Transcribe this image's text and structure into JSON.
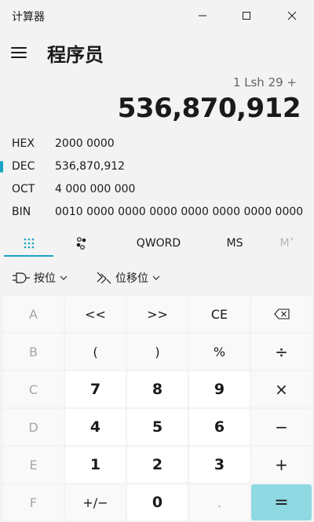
{
  "window": {
    "title": "计算器"
  },
  "header": {
    "mode_title": "程序员"
  },
  "display": {
    "expression": "1 Lsh 29 +",
    "result": "536,870,912"
  },
  "radix": [
    {
      "name": "HEX",
      "value": "2000 0000",
      "selected": false
    },
    {
      "name": "DEC",
      "value": "536,870,912",
      "selected": true
    },
    {
      "name": "OCT",
      "value": "4 000 000 000",
      "selected": false
    },
    {
      "name": "BIN",
      "value": "0010 0000 0000 0000 0000 0000 0000 0000",
      "selected": false
    }
  ],
  "tabs": {
    "keypad_icon": "keypad-icon",
    "bit_toggle_icon": "bit-toggle-icon",
    "word_size": "QWORD",
    "memory_store": "MS",
    "memory_recall": "M˅"
  },
  "bitwise": {
    "label": "按位",
    "shift_label": "位移位"
  },
  "keys": {
    "r1": [
      "A",
      "<<",
      ">>",
      "CE",
      "⌫"
    ],
    "r2": [
      "B",
      "(",
      ")",
      "%",
      "÷"
    ],
    "r3": [
      "C",
      "7",
      "8",
      "9",
      "×"
    ],
    "r4": [
      "D",
      "4",
      "5",
      "6",
      "−"
    ],
    "r5": [
      "E",
      "1",
      "2",
      "3",
      "+"
    ],
    "r6": [
      "F",
      "+/−",
      "0",
      ".",
      "="
    ]
  },
  "colors": {
    "accent": "#1aa3c4",
    "equals_bg": "#8fd9e3",
    "background": "#f3f3f3"
  }
}
